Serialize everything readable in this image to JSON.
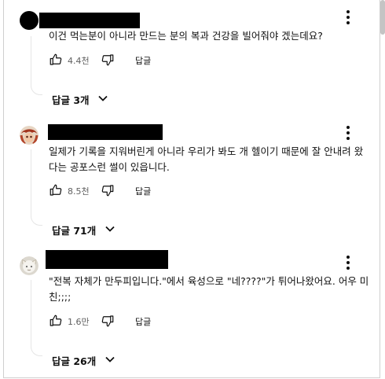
{
  "comments": [
    {
      "text": "이건 먹는분이 아니라 만드는 분의 복과 건강을 빌어줘야 겠는데요?",
      "likes": "4.4천",
      "reply_label": "답글",
      "replies_label": "답글 3개",
      "avatar": "black-circle-avatar"
    },
    {
      "text": "일제가 기록을 지워버린게 아니라 우리가 봐도 개 헬이기 때문에 잘 안내려 왔다는 공포스런 썰이 있읍니다.",
      "likes": "8.5천",
      "reply_label": "답글",
      "replies_label": "답글 71개",
      "avatar": "character-avatar-red"
    },
    {
      "text": "\"전복 자체가 만두피입니다.\"에서 육성으로 \"네????\"가 튀어나왔어요. 어우 미친;;;;",
      "likes": "1.6만",
      "reply_label": "답글",
      "replies_label": "답글 26개",
      "avatar": "character-avatar-white"
    }
  ],
  "icons": {
    "like": "thumbs-up-icon",
    "dislike": "thumbs-down-icon",
    "more": "more-vert-icon",
    "expand": "chevron-down-icon"
  },
  "colors": {
    "text": "#0f0f0f",
    "secondary": "#606060",
    "divider": "#cfcfcf"
  }
}
